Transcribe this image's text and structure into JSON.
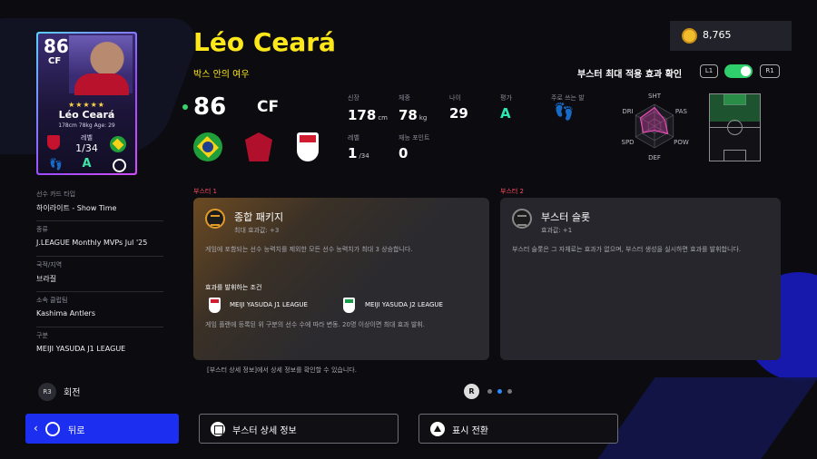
{
  "card": {
    "rating": "86",
    "position": "CF",
    "stars": "★★★★★",
    "name": "Léo Ceará",
    "meta": "178cm 78kg Age: 29",
    "level_label": "레벨",
    "level": "1/34",
    "grade": "A"
  },
  "info": [
    {
      "label": "선수 카드 타입",
      "value": "하이라이트 - Show Time"
    },
    {
      "label": "종류",
      "value": "J.LEAGUE Monthly MVPs Jul '25"
    },
    {
      "label": "국적/지역",
      "value": "브라질"
    },
    {
      "label": "소속 클럽팀",
      "value": "Kashima Antlers"
    },
    {
      "label": "구분",
      "value": "MEIJI YASUDA J1 LEAGUE"
    }
  ],
  "rotate": {
    "button": "R3",
    "label": "회전"
  },
  "header": {
    "name": "Léo Ceará",
    "subtitle": "박스 안의 여우",
    "coins": "8,765",
    "boost_toggle_label": "부스터 최대 적용 효과 확인",
    "l1": "L1",
    "r1": "R1",
    "toggle_on": true
  },
  "overview": {
    "rating": "86",
    "position": "CF",
    "stats": {
      "height_label": "신장",
      "height": "178",
      "height_unit": "cm",
      "weight_label": "체중",
      "weight": "78",
      "weight_unit": "kg",
      "age_label": "나이",
      "age": "29",
      "grade_label": "평가",
      "grade": "A",
      "foot_label": "주로 쓰는 발",
      "level_label": "레벨",
      "level": "1",
      "level_max": "/34",
      "skill_label": "재능 포인트",
      "skill": "0"
    }
  },
  "radar": {
    "labels": [
      "SHT",
      "PAS",
      "POW",
      "DEF",
      "SPD",
      "DRI"
    ],
    "values": [
      0.85,
      0.55,
      0.7,
      0.2,
      0.6,
      0.75
    ]
  },
  "booster1": {
    "header": "부스터 1",
    "name": "종합 패키지",
    "effect": "최대 효과값: +3",
    "description": "게임에 포함되는 선수 능력치를 제외한 모든 선수 능력치가 최대 3 상승합니다.",
    "condition_title": "효과를 발휘하는 조건",
    "league1": "MEIJI YASUDA J1 LEAGUE",
    "league2": "MEIJI YASUDA J2 LEAGUE",
    "condition_desc": "게임 플랜에 등록된 위 구분의 선수 수에 따라 변동. 20명 이상이면 최대 효과 발휘."
  },
  "booster2": {
    "header": "부스터 2",
    "name": "부스터 슬롯",
    "effect": "효과값: +1",
    "description": "부스터 슬롯은 그 자체로는 효과가 없으며, 부스터 생성을 실시하면 효과를 발휘합니다."
  },
  "footnote": "[부스터 상세 정보]에서 상세 정보를 확인할 수 있습니다.",
  "pager": {
    "button": "R",
    "active": 1,
    "count": 3
  },
  "buttons": {
    "back": "뒤로",
    "booster_detail": "부스터 상세 정보",
    "toggle_view": "표시 전환"
  }
}
